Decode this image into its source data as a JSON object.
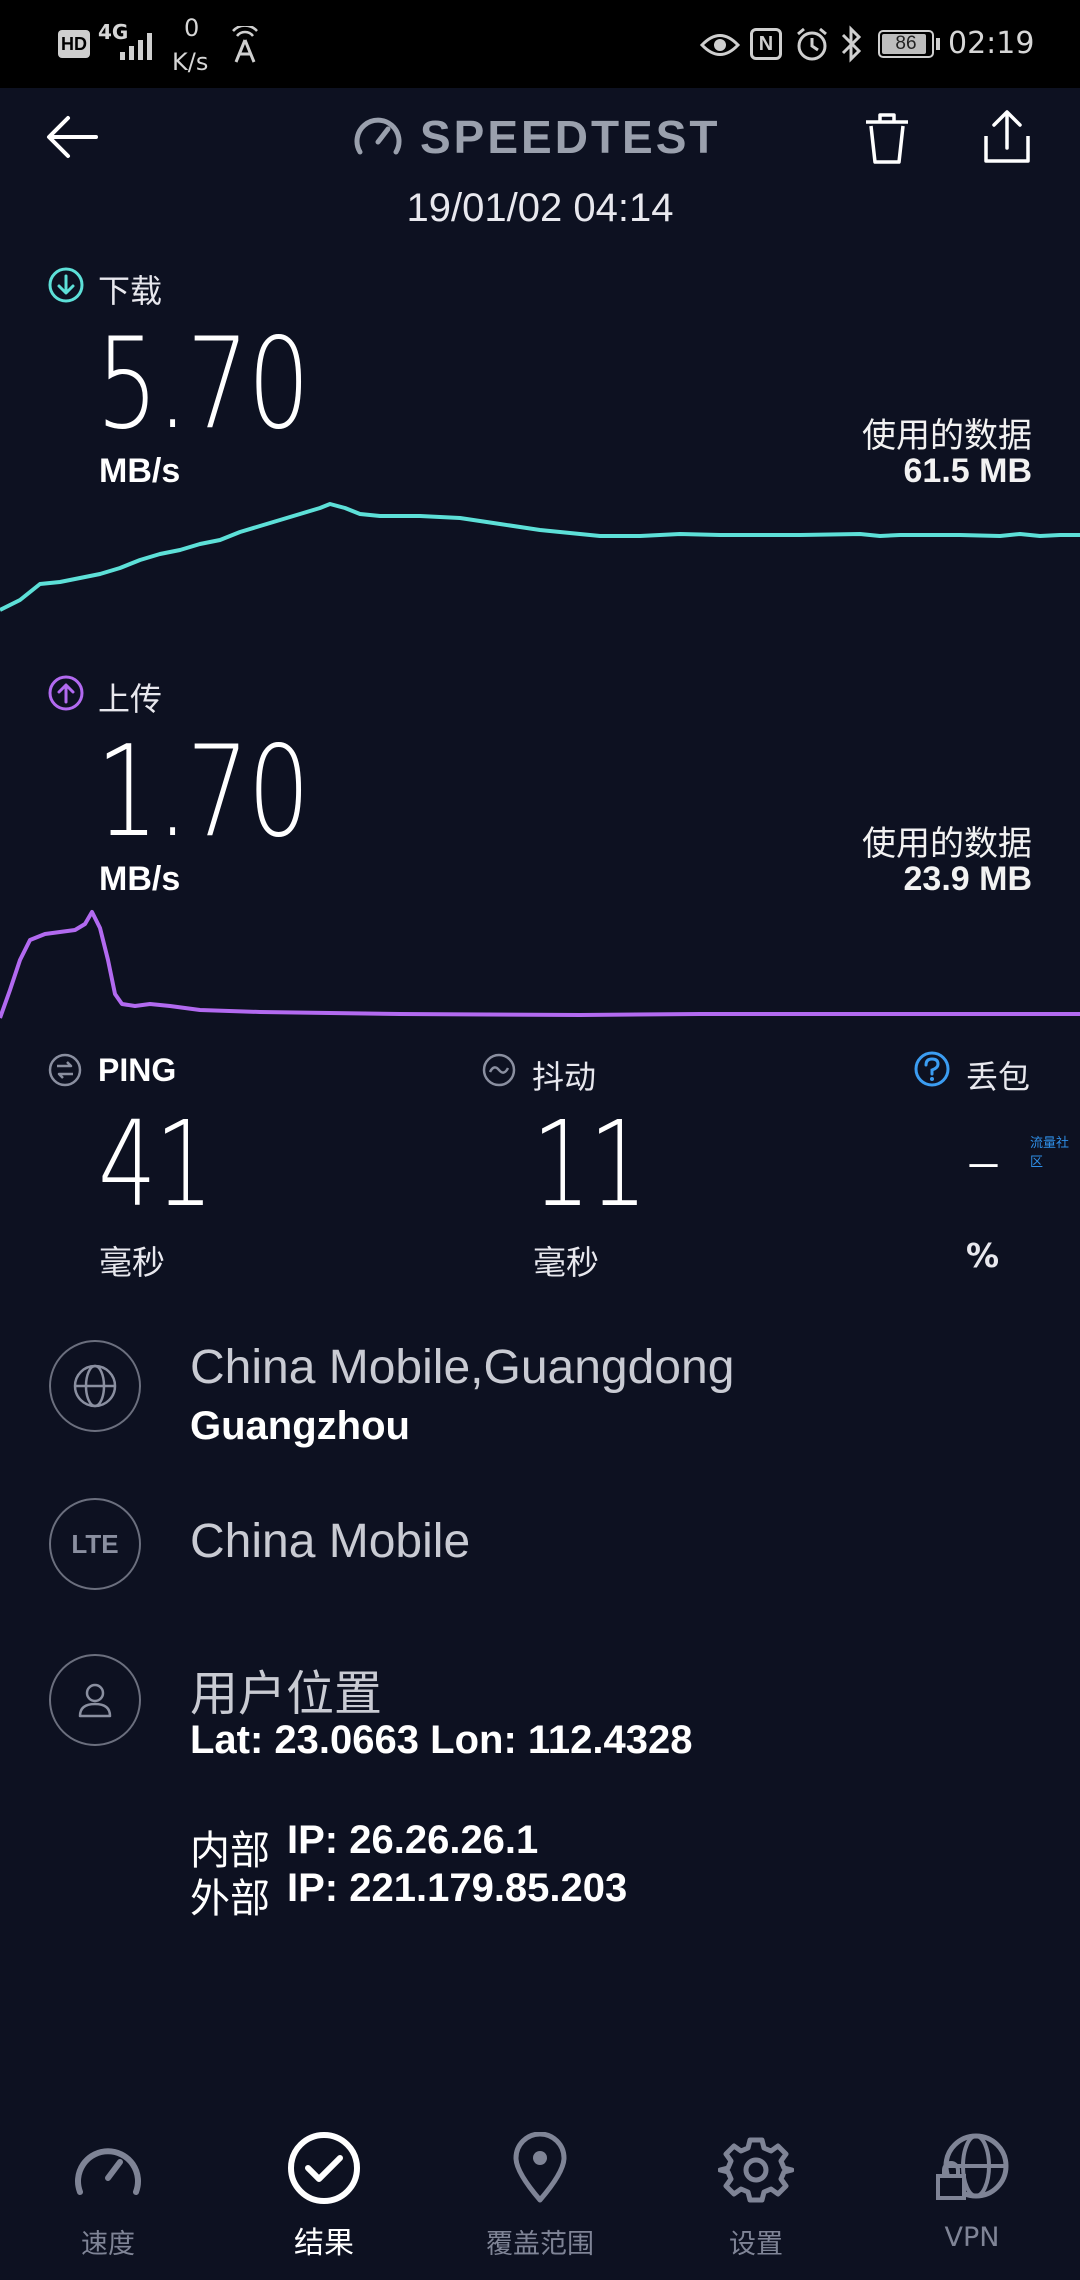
{
  "status_bar": {
    "net_speed_value": "0",
    "net_speed_unit": "K/s",
    "battery": "86",
    "time": "02:19",
    "hd_label": "HD",
    "network_label": "4G"
  },
  "header": {
    "title": "SPEEDTEST",
    "datetime": "19/01/02 04:14"
  },
  "download": {
    "label": "下载",
    "value": "5.70",
    "unit": "MB/s",
    "data_used_label": "使用的数据",
    "data_used_value": "61.5 MB",
    "color": "#5de0d8"
  },
  "upload": {
    "label": "上传",
    "value": "1.70",
    "unit": "MB/s",
    "data_used_label": "使用的数据",
    "data_used_value": "23.9 MB",
    "color": "#b26af0"
  },
  "metrics": {
    "ping": {
      "label": "PING",
      "value": "41",
      "unit": "毫秒"
    },
    "jitter": {
      "label": "抖动",
      "value": "11",
      "unit": "毫秒"
    },
    "packet_loss": {
      "label": "丢包",
      "value": "–",
      "unit": "%",
      "help_color": "#3b9df2"
    }
  },
  "watermark": "流量社区",
  "info": {
    "isp_location": "China Mobile,Guangdong",
    "city": "Guangzhou",
    "network_type_badge": "LTE",
    "carrier": "China Mobile",
    "user_location_label": "用户位置",
    "coords": "Lat: 23.0663 Lon: 112.4328",
    "internal_ip_label": "内部",
    "internal_ip": "IP: 26.26.26.1",
    "external_ip_label": "外部",
    "external_ip": "IP: 221.179.85.203"
  },
  "bottom_nav": [
    {
      "label": "速度",
      "icon": "speedometer-icon",
      "active": false
    },
    {
      "label": "结果",
      "icon": "check-circle-icon",
      "active": true
    },
    {
      "label": "覆盖范围",
      "icon": "map-pin-icon",
      "active": false
    },
    {
      "label": "设置",
      "icon": "gear-icon",
      "active": false
    },
    {
      "label": "VPN",
      "icon": "vpn-globe-lock-icon",
      "active": false
    }
  ]
}
